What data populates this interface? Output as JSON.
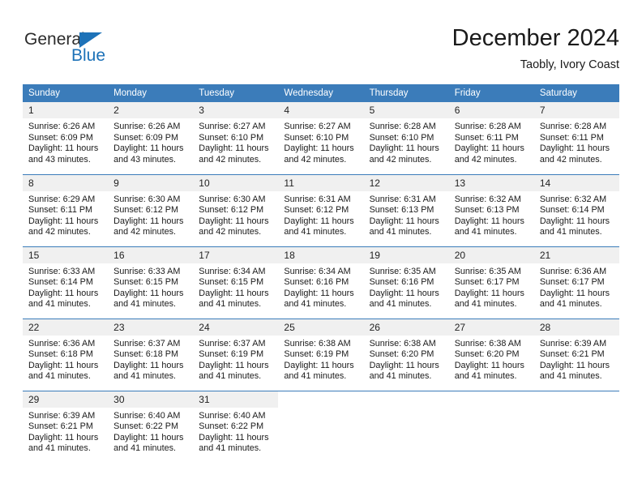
{
  "brand": {
    "name_line1": "General",
    "name_line2": "Blue",
    "triangle_icon": "triangle-icon",
    "accent_color": "#1d72b8"
  },
  "header": {
    "month_title": "December 2024",
    "location": "Taobly, Ivory Coast"
  },
  "calendar": {
    "header_bg": "#3b7cba",
    "daynum_bg": "#f0f0f0",
    "weekday_headers": [
      "Sunday",
      "Monday",
      "Tuesday",
      "Wednesday",
      "Thursday",
      "Friday",
      "Saturday"
    ],
    "weeks": [
      [
        {
          "day": "1",
          "sunrise": "Sunrise: 6:26 AM",
          "sunset": "Sunset: 6:09 PM",
          "daylight_line1": "Daylight: 11 hours",
          "daylight_line2": "and 43 minutes."
        },
        {
          "day": "2",
          "sunrise": "Sunrise: 6:26 AM",
          "sunset": "Sunset: 6:09 PM",
          "daylight_line1": "Daylight: 11 hours",
          "daylight_line2": "and 43 minutes."
        },
        {
          "day": "3",
          "sunrise": "Sunrise: 6:27 AM",
          "sunset": "Sunset: 6:10 PM",
          "daylight_line1": "Daylight: 11 hours",
          "daylight_line2": "and 42 minutes."
        },
        {
          "day": "4",
          "sunrise": "Sunrise: 6:27 AM",
          "sunset": "Sunset: 6:10 PM",
          "daylight_line1": "Daylight: 11 hours",
          "daylight_line2": "and 42 minutes."
        },
        {
          "day": "5",
          "sunrise": "Sunrise: 6:28 AM",
          "sunset": "Sunset: 6:10 PM",
          "daylight_line1": "Daylight: 11 hours",
          "daylight_line2": "and 42 minutes."
        },
        {
          "day": "6",
          "sunrise": "Sunrise: 6:28 AM",
          "sunset": "Sunset: 6:11 PM",
          "daylight_line1": "Daylight: 11 hours",
          "daylight_line2": "and 42 minutes."
        },
        {
          "day": "7",
          "sunrise": "Sunrise: 6:28 AM",
          "sunset": "Sunset: 6:11 PM",
          "daylight_line1": "Daylight: 11 hours",
          "daylight_line2": "and 42 minutes."
        }
      ],
      [
        {
          "day": "8",
          "sunrise": "Sunrise: 6:29 AM",
          "sunset": "Sunset: 6:11 PM",
          "daylight_line1": "Daylight: 11 hours",
          "daylight_line2": "and 42 minutes."
        },
        {
          "day": "9",
          "sunrise": "Sunrise: 6:30 AM",
          "sunset": "Sunset: 6:12 PM",
          "daylight_line1": "Daylight: 11 hours",
          "daylight_line2": "and 42 minutes."
        },
        {
          "day": "10",
          "sunrise": "Sunrise: 6:30 AM",
          "sunset": "Sunset: 6:12 PM",
          "daylight_line1": "Daylight: 11 hours",
          "daylight_line2": "and 42 minutes."
        },
        {
          "day": "11",
          "sunrise": "Sunrise: 6:31 AM",
          "sunset": "Sunset: 6:12 PM",
          "daylight_line1": "Daylight: 11 hours",
          "daylight_line2": "and 41 minutes."
        },
        {
          "day": "12",
          "sunrise": "Sunrise: 6:31 AM",
          "sunset": "Sunset: 6:13 PM",
          "daylight_line1": "Daylight: 11 hours",
          "daylight_line2": "and 41 minutes."
        },
        {
          "day": "13",
          "sunrise": "Sunrise: 6:32 AM",
          "sunset": "Sunset: 6:13 PM",
          "daylight_line1": "Daylight: 11 hours",
          "daylight_line2": "and 41 minutes."
        },
        {
          "day": "14",
          "sunrise": "Sunrise: 6:32 AM",
          "sunset": "Sunset: 6:14 PM",
          "daylight_line1": "Daylight: 11 hours",
          "daylight_line2": "and 41 minutes."
        }
      ],
      [
        {
          "day": "15",
          "sunrise": "Sunrise: 6:33 AM",
          "sunset": "Sunset: 6:14 PM",
          "daylight_line1": "Daylight: 11 hours",
          "daylight_line2": "and 41 minutes."
        },
        {
          "day": "16",
          "sunrise": "Sunrise: 6:33 AM",
          "sunset": "Sunset: 6:15 PM",
          "daylight_line1": "Daylight: 11 hours",
          "daylight_line2": "and 41 minutes."
        },
        {
          "day": "17",
          "sunrise": "Sunrise: 6:34 AM",
          "sunset": "Sunset: 6:15 PM",
          "daylight_line1": "Daylight: 11 hours",
          "daylight_line2": "and 41 minutes."
        },
        {
          "day": "18",
          "sunrise": "Sunrise: 6:34 AM",
          "sunset": "Sunset: 6:16 PM",
          "daylight_line1": "Daylight: 11 hours",
          "daylight_line2": "and 41 minutes."
        },
        {
          "day": "19",
          "sunrise": "Sunrise: 6:35 AM",
          "sunset": "Sunset: 6:16 PM",
          "daylight_line1": "Daylight: 11 hours",
          "daylight_line2": "and 41 minutes."
        },
        {
          "day": "20",
          "sunrise": "Sunrise: 6:35 AM",
          "sunset": "Sunset: 6:17 PM",
          "daylight_line1": "Daylight: 11 hours",
          "daylight_line2": "and 41 minutes."
        },
        {
          "day": "21",
          "sunrise": "Sunrise: 6:36 AM",
          "sunset": "Sunset: 6:17 PM",
          "daylight_line1": "Daylight: 11 hours",
          "daylight_line2": "and 41 minutes."
        }
      ],
      [
        {
          "day": "22",
          "sunrise": "Sunrise: 6:36 AM",
          "sunset": "Sunset: 6:18 PM",
          "daylight_line1": "Daylight: 11 hours",
          "daylight_line2": "and 41 minutes."
        },
        {
          "day": "23",
          "sunrise": "Sunrise: 6:37 AM",
          "sunset": "Sunset: 6:18 PM",
          "daylight_line1": "Daylight: 11 hours",
          "daylight_line2": "and 41 minutes."
        },
        {
          "day": "24",
          "sunrise": "Sunrise: 6:37 AM",
          "sunset": "Sunset: 6:19 PM",
          "daylight_line1": "Daylight: 11 hours",
          "daylight_line2": "and 41 minutes."
        },
        {
          "day": "25",
          "sunrise": "Sunrise: 6:38 AM",
          "sunset": "Sunset: 6:19 PM",
          "daylight_line1": "Daylight: 11 hours",
          "daylight_line2": "and 41 minutes."
        },
        {
          "day": "26",
          "sunrise": "Sunrise: 6:38 AM",
          "sunset": "Sunset: 6:20 PM",
          "daylight_line1": "Daylight: 11 hours",
          "daylight_line2": "and 41 minutes."
        },
        {
          "day": "27",
          "sunrise": "Sunrise: 6:38 AM",
          "sunset": "Sunset: 6:20 PM",
          "daylight_line1": "Daylight: 11 hours",
          "daylight_line2": "and 41 minutes."
        },
        {
          "day": "28",
          "sunrise": "Sunrise: 6:39 AM",
          "sunset": "Sunset: 6:21 PM",
          "daylight_line1": "Daylight: 11 hours",
          "daylight_line2": "and 41 minutes."
        }
      ],
      [
        {
          "day": "29",
          "sunrise": "Sunrise: 6:39 AM",
          "sunset": "Sunset: 6:21 PM",
          "daylight_line1": "Daylight: 11 hours",
          "daylight_line2": "and 41 minutes."
        },
        {
          "day": "30",
          "sunrise": "Sunrise: 6:40 AM",
          "sunset": "Sunset: 6:22 PM",
          "daylight_line1": "Daylight: 11 hours",
          "daylight_line2": "and 41 minutes."
        },
        {
          "day": "31",
          "sunrise": "Sunrise: 6:40 AM",
          "sunset": "Sunset: 6:22 PM",
          "daylight_line1": "Daylight: 11 hours",
          "daylight_line2": "and 41 minutes."
        },
        {
          "day": "",
          "sunrise": "",
          "sunset": "",
          "daylight_line1": "",
          "daylight_line2": ""
        },
        {
          "day": "",
          "sunrise": "",
          "sunset": "",
          "daylight_line1": "",
          "daylight_line2": ""
        },
        {
          "day": "",
          "sunrise": "",
          "sunset": "",
          "daylight_line1": "",
          "daylight_line2": ""
        },
        {
          "day": "",
          "sunrise": "",
          "sunset": "",
          "daylight_line1": "",
          "daylight_line2": ""
        }
      ]
    ]
  }
}
